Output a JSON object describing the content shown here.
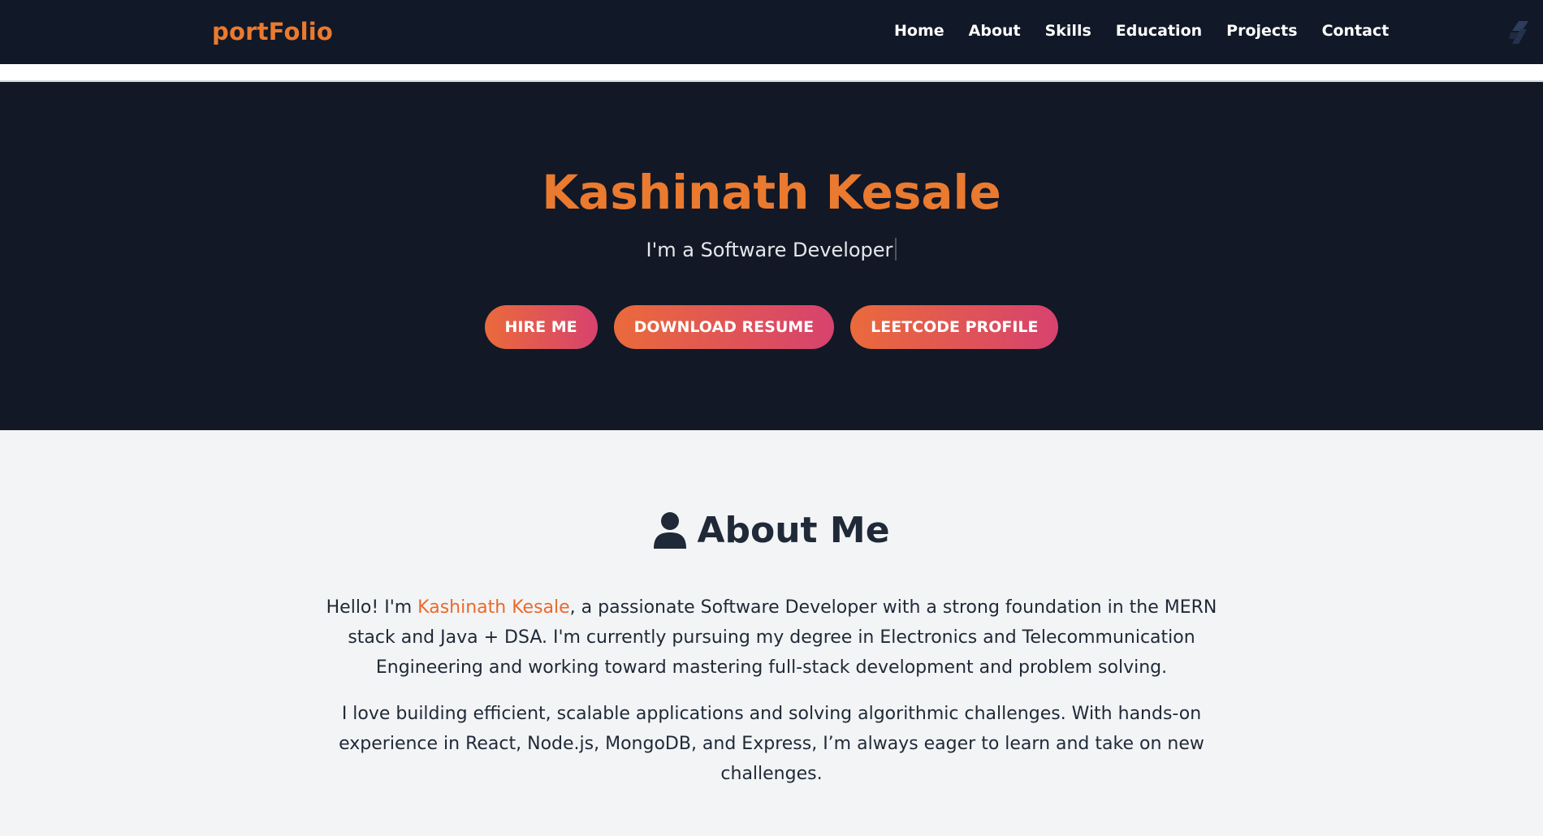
{
  "nav": {
    "brand": "portFolio",
    "links": [
      "Home",
      "About",
      "Skills",
      "Education",
      "Projects",
      "Contact"
    ]
  },
  "hero": {
    "name": "Kashinath Kesale",
    "subtitle": "I'm a Software Developer",
    "buttons": [
      "HIRE ME",
      "DOWNLOAD RESUME",
      "LEETCODE PROFILE"
    ]
  },
  "about": {
    "title": "About Me",
    "p1_prefix": "Hello! I'm ",
    "p1_name": "Kashinath Kesale",
    "p1_rest": ", a passionate Software Developer with a strong foundation in the MERN stack and Java + DSA. I'm currently pursuing my degree in Electronics and Telecommunication Engineering and working toward mastering full-stack development and problem solving.",
    "p2": "I love building efficient, scalable applications and solving algorithmic challenges. With hands-on experience in React, Node.js, MongoDB, and Express, I’m always eager to learn and take on new challenges."
  },
  "colors": {
    "accent": "#ea7a2f",
    "nav_bg": "#111827",
    "hero_bg": "#121826",
    "button_gradient_start": "#ea6a3b",
    "button_gradient_end": "#d7426e",
    "page_bg": "#f3f4f6"
  },
  "icons": [
    "stack-logo-icon",
    "user-icon"
  ]
}
